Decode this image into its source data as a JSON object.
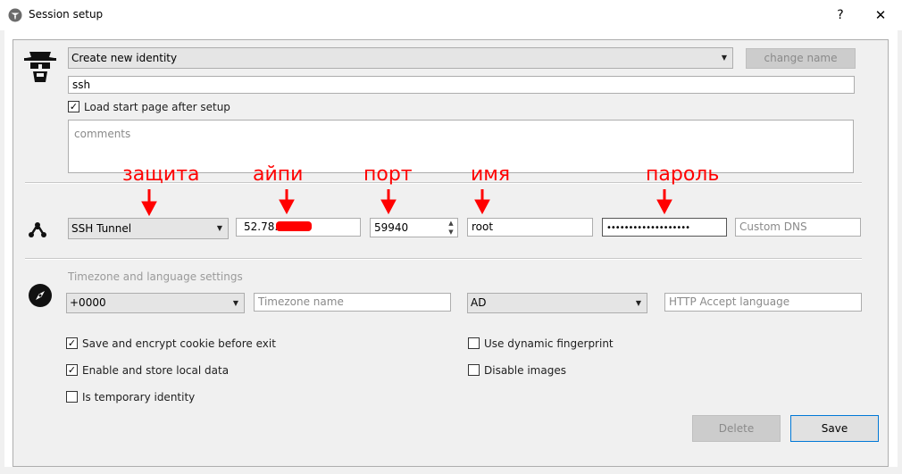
{
  "window": {
    "title": "Session setup",
    "help": "?",
    "close": "✕"
  },
  "identity": {
    "select_value": "Create new identity",
    "change_name_label": "change name",
    "name_value": "ssh",
    "load_start_page_label": "Load start page after setup",
    "load_start_page_checked": true,
    "comments_placeholder": "comments"
  },
  "network": {
    "protocol_value": "SSH Tunnel",
    "ip_value": "52.78.",
    "port_value": "59940",
    "user_value": "root",
    "password_mask": "•••••••••••••••••••",
    "custom_dns_placeholder": "Custom DNS"
  },
  "annotations": {
    "protection": "защита",
    "ip": "айпи",
    "port": "порт",
    "name": "имя",
    "password": "пароль"
  },
  "timezone": {
    "section_title": "Timezone and language settings",
    "tz_value": "+0000",
    "tz_name_placeholder": "Timezone name",
    "lang_value": "AD",
    "accept_lang_placeholder": "HTTP Accept language"
  },
  "options": {
    "save_cookie": {
      "label": "Save and encrypt cookie before exit",
      "checked": true
    },
    "local_data": {
      "label": "Enable and store local data",
      "checked": true
    },
    "temporary": {
      "label": "Is temporary identity",
      "checked": false
    },
    "dynamic_fp": {
      "label": "Use dynamic fingerprint",
      "checked": false
    },
    "disable_images": {
      "label": "Disable images",
      "checked": false
    }
  },
  "footer": {
    "delete_label": "Delete",
    "save_label": "Save"
  },
  "colors": {
    "annotation": "#ff0000",
    "accent": "#0078d7"
  }
}
